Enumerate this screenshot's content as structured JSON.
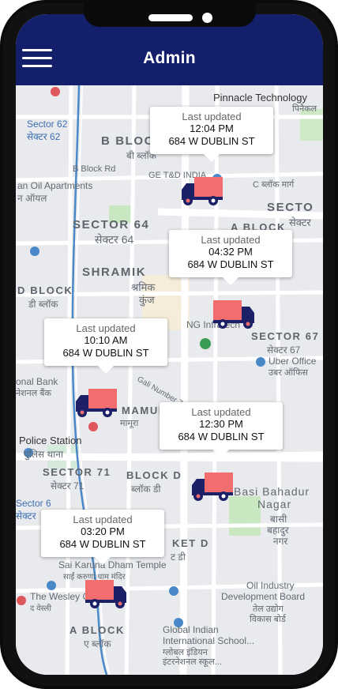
{
  "header": {
    "title": "Admin"
  },
  "map": {
    "labels": {
      "pinnacle": "Pinnacle Technology",
      "pinnacle_hi": "पिनैकल",
      "sector62": "Sector 62",
      "sector62_hi": "सेक्टर 62",
      "bblock": "B BLOCK",
      "bblock_hi": "बी ब्लॉक",
      "bblock_road": "B Block Rd",
      "oil_apts": "an Oil Apartments",
      "oil_apts_hi": "न ऑयल",
      "ge_india": "GE T&D INDIA",
      "cblock_marg": "C ब्लॉक मार्ग",
      "sector64": "SECTOR 64",
      "sector64_hi": "सेक्टर 64",
      "ablock": "A BLOCK",
      "secto": "SECTO",
      "secto_hi": "सेक्टर",
      "shramik": "SHRAMIK",
      "shramik_hi": "श्रमिक",
      "shramik_hi2": "कुंज",
      "dblock": "D BLOCK",
      "dblock_hi": "डी ब्लॉक",
      "infratech": "NG Infratech",
      "sector67": "SECTOR 67",
      "sector67_hi": "सेक्टर 67",
      "uber": "Uber Office",
      "uber_hi": "उबर ऑफिस",
      "nat_bank": "onal Bank",
      "nat_bank_hi": "नेशनल बैंक",
      "gali": "Gali Number 7",
      "mamura": "MAMURA",
      "mamura_hi": "मामूरा",
      "police": "Police Station",
      "police_hi": "पुलिस थाना",
      "sector71": "SECTOR 71",
      "sector71_hi": "सेक्टर 71",
      "dblock2": "BLOCK D",
      "dblock2_hi": "ब्लॉक डी",
      "basi": "Basi Bahadur",
      "basi2": "Nagar",
      "basi_hi": "बासी",
      "basi_hi2": "बहादुर",
      "basi_hi3": "नगर",
      "sector6": "Sector 6",
      "sector6_hi": "सेक्टर",
      "ket": "KET D",
      "ket_hi": "ट डी",
      "sai": "Sai Karuna Dham Temple",
      "sai_hi": "साईं करुणा धाम मंदिर",
      "wesley": "The Wesley G",
      "wesley_hi": "द वेस्ली",
      "oil_dev": "Oil Industry",
      "oil_dev2": "Development Board",
      "oil_dev_hi": "तेल उद्योग",
      "oil_dev_hi2": "विकास बोर्ड",
      "ablock2": "A BLOCK",
      "ablock2_hi": "ए ब्लॉक",
      "global": "Global Indian",
      "global2": "International School...",
      "global_hi": "ग्लोबल इंडियन",
      "global_hi2": "इंटरनेशनल स्कूल..."
    }
  },
  "vehicles": [
    {
      "label": "Last updated",
      "time": "12:04 PM",
      "address": "684 W DUBLIN ST"
    },
    {
      "label": "Last updated",
      "time": "04:32 PM",
      "address": "684 W DUBLIN ST"
    },
    {
      "label": "Last updated",
      "time": "10:10 AM",
      "address": "684 W DUBLIN ST"
    },
    {
      "label": "Last updated",
      "time": "12:30 PM",
      "address": "684 W DUBLIN ST"
    },
    {
      "label": "Last updated",
      "time": "03:20 PM",
      "address": "684 W DUBLIN ST"
    }
  ],
  "colors": {
    "header": "#131f6b",
    "truck_cargo": "#f26d6d",
    "truck_cab": "#1c2066",
    "wheel_hub": "#f26d6d"
  }
}
